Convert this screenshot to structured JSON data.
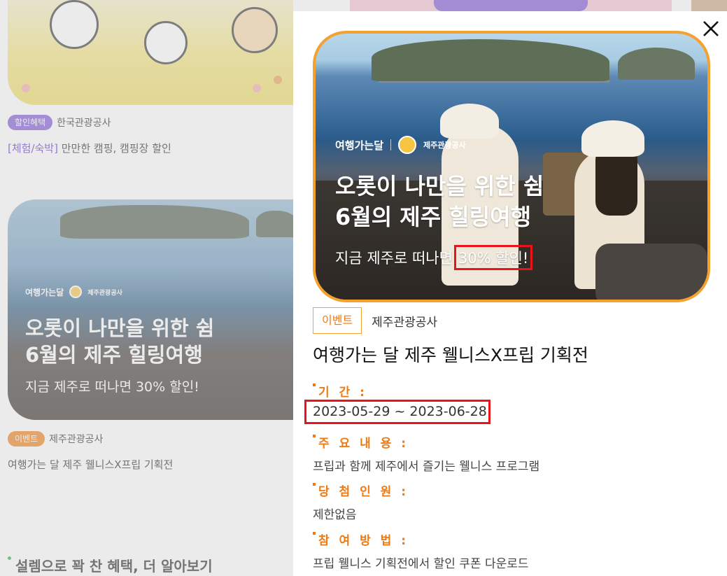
{
  "background": {
    "card1": {
      "badge": "할인혜택",
      "org": "한국관광공사",
      "category": "[체험/숙박]",
      "title": " 만만한 캠핑, 캠핑장 할인"
    },
    "card2": {
      "banner_brand": "여행가는달",
      "banner_org": "제주관광공사",
      "banner_line1": "오롯이 나만을 위한 쉼",
      "banner_line2": "6월의 제주 힐링여행",
      "banner_sub": "지금 제주로 떠나면 30% 할인!",
      "badge": "이벤트",
      "org": "제주관광공사",
      "title": "여행가는 달 제주 웰니스X프립 기획전"
    },
    "bottom_link": "설렘으로 꽉 찬 혜택, 더 알아보기"
  },
  "modal": {
    "close_icon": "close-icon",
    "banner": {
      "brand": "여행가는달",
      "org": "제주관광공사",
      "line1": "오롯이 나만을 위한 쉼",
      "line2": "6월의 제주 힐링여행",
      "sub_prefix": "지금 제주로 떠나면",
      "sub_highlight": "30% 할인!"
    },
    "tag": "이벤트",
    "org": "제주관광공사",
    "title": "여행가는 달 제주 웰니스X프립 기획전",
    "sections": {
      "period_label": "기 간 :",
      "period_value": "2023-05-29 ~ 2023-06-28",
      "main_label": "주 요 내 용 :",
      "main_value": "프립과 함께 제주에서 즐기는 웰니스 프로그램",
      "winner_label": "당 첨 인 원 :",
      "winner_value": "제한없음",
      "method_label": "참 여 방 법 :",
      "method_value": "프립 웰니스 기획전에서 할인 쿠폰 다운로드"
    }
  },
  "colors": {
    "accent_orange": "#f07a12",
    "banner_border": "#f3a12f",
    "highlight_red": "#e8141a",
    "badge_purple": "#7b52d6"
  }
}
